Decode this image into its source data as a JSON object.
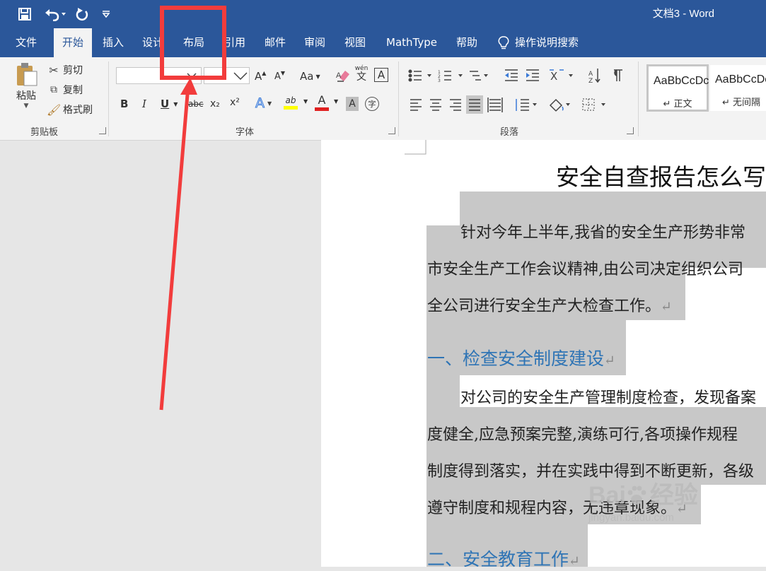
{
  "titlebar": {
    "doc_title": "文档3  -  Word",
    "qat_icons": [
      "save-icon",
      "undo-icon",
      "redo-icon",
      "customize-qat-icon"
    ]
  },
  "tabs": [
    "文件",
    "开始",
    "插入",
    "设计",
    "布局",
    "引用",
    "邮件",
    "审阅",
    "视图",
    "MathType",
    "帮助"
  ],
  "active_tab": "开始",
  "tell_me": "操作说明搜索",
  "clipboard": {
    "paste": "粘贴",
    "cut": "剪切",
    "copy": "复制",
    "format_painter": "格式刷",
    "label": "剪贴板"
  },
  "font": {
    "label": "字体",
    "font_name_value": "",
    "font_size_value": "",
    "grow": "A",
    "shrink": "A",
    "change_case": "Aa",
    "phonetic_top": "wén",
    "phonetic_bottom": "文",
    "border_char": "A",
    "bold": "B",
    "italic": "I",
    "underline": "U",
    "strikethrough": "abc",
    "subscript": "x₂",
    "superscript": "x²",
    "text_effects": "A",
    "highlight": "ab",
    "font_color": "A",
    "char_shading": "A",
    "enclose": "字",
    "highlight_color": "#ffff00",
    "font_color_value": "#e02020"
  },
  "paragraph": {
    "label": "段落"
  },
  "styles": {
    "items": [
      {
        "sample": "AaBbCcDc",
        "name": "↵ 正文"
      },
      {
        "sample": "AaBbCcDc",
        "name": "↵ 无间隔"
      }
    ]
  },
  "document": {
    "title": "安全自查报告怎么写",
    "lines": [
      "针对今年上半年,我省的安全生产形势非常",
      "市安全生产工作会议精神,由公司决定组织公司",
      "全公司进行安全生产大检查工作。",
      "一、检查安全制度建设",
      "对公司的安全生产管理制度检查，发现备案",
      "度健全,应急预案完整,演练可行,各项操作规程",
      "制度得到落实，并在实践中得到不断更新，各级",
      "遵守制度和规程内容，无违章现象。",
      "二、安全教育工作"
    ],
    "pilcrow": "↵"
  },
  "watermark": {
    "brand_left": "Bai",
    "brand_right": "经验",
    "url": "jingyan.baidu.com"
  },
  "annotation": {
    "color": "#f23c3c"
  }
}
